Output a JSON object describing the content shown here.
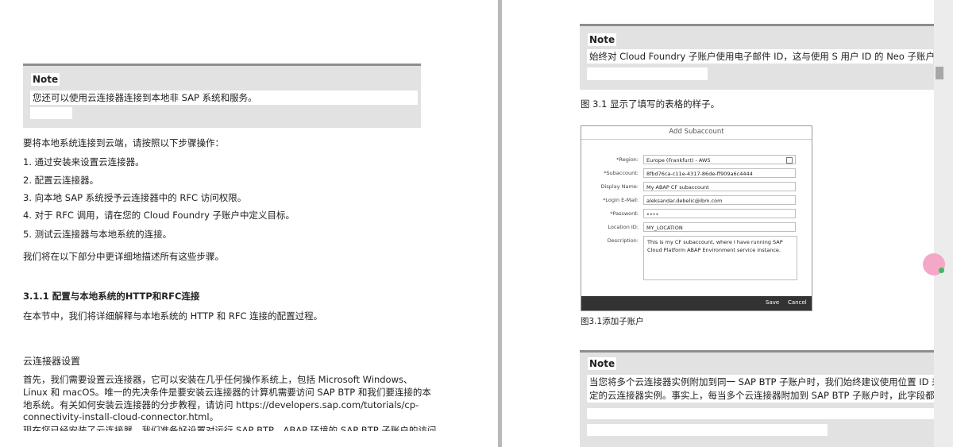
{
  "left_page": {
    "note": {
      "title": "Note",
      "text": "您还可以使用云连接器连接到本地非 SAP 系统和服务。"
    },
    "intro": "要将本地系统连接到云端，请按照以下步骤操作：",
    "steps": [
      "1. 通过安装来设置云连接器。",
      "2. 配置云连接器。",
      "3. 向本地 SAP 系统授予云连接器中的 RFC 访问权限。",
      "4. 对于 RFC 调用，请在您的 Cloud Foundry 子账户中定义目标。",
      "5. 测试云连接器与本地系统的连接。"
    ],
    "describe_all": "我们将在以下部分中更详细地描述所有这些步骤。",
    "section_heading": "3.1.1 配置与本地系统的HTTP和RFC连接",
    "section_intro": "在本节中，我们将详细解释与本地系统的 HTTP 和 RFC 连接的配置过程。",
    "subheading": "云连接器设置",
    "paragraph_lines": [
      "首先，我们需要设置云连接器，它可以安装在几乎任何操作系统上，包括 Microsoft Windows、",
      "Linux 和 macOS。唯一的先决条件是要安装云连接器的计算机需要访问 SAP BTP 和我们要连接的本",
      "地系统。有关如何安装云连接器的分步教程，请访问 https://developers.sap.com/tutorials/cp-",
      "connectivity-install-cloud-connector.html。",
      "现在您已经安装了云连接器，我们准备好设置对运行 SAP BTP，ABAP 环境的 SAP BTP 子账户的访问"
    ]
  },
  "right_page": {
    "note1": {
      "title": "Note",
      "text": "始终对 Cloud Foundry 子账户使用电子邮件 ID，这与使用 S 用户 ID 的 Neo 子账户不同。"
    },
    "fig_ref": "图 3.1 显示了填写的表格的样子。",
    "form": {
      "title": "Add Subaccount",
      "fields": [
        {
          "label": "*Region:",
          "value": "Europe (Frankfurt) - AWS"
        },
        {
          "label": "*Subaccount:",
          "value": "8fbd76ca-c11e-4317-86de-ff909a6c4444"
        },
        {
          "label": "Display Name:",
          "value": "My ABAP CF subaccount"
        },
        {
          "label": "*Login E-Mail:",
          "value": "aleksandar.debelic@ibm.com"
        },
        {
          "label": "*Password:",
          "value": "••••"
        },
        {
          "label": "Location ID:",
          "value": "MY_LOCATION"
        }
      ],
      "description_label": "Description:",
      "description_value": "This is my CF subaccount, where I have running SAP Cloud Platform ABAP Environment service instance.",
      "save_label": "Save",
      "cancel_label": "Cancel"
    },
    "fig_caption": "图3.1添加子账户",
    "note2": {
      "title": "Note",
      "lines": [
        "当您将多个云连接器实例附加到同一 SAP BTP 子账户时，我们始终建议使用位置 ID 来轻",
        "定的云连接器实例。事实上，每当多个云连接器附加到 SAP BTP 子账户时，此字段都是强"
      ]
    }
  },
  "colors": {
    "note_bg": "#e2e2e2",
    "note_border": "#8e8e8e",
    "form_footer": "#333333"
  },
  "icons": [
    "play-icon",
    "stop-icon",
    "copy-icon",
    "assistant-bubble-icon"
  ]
}
